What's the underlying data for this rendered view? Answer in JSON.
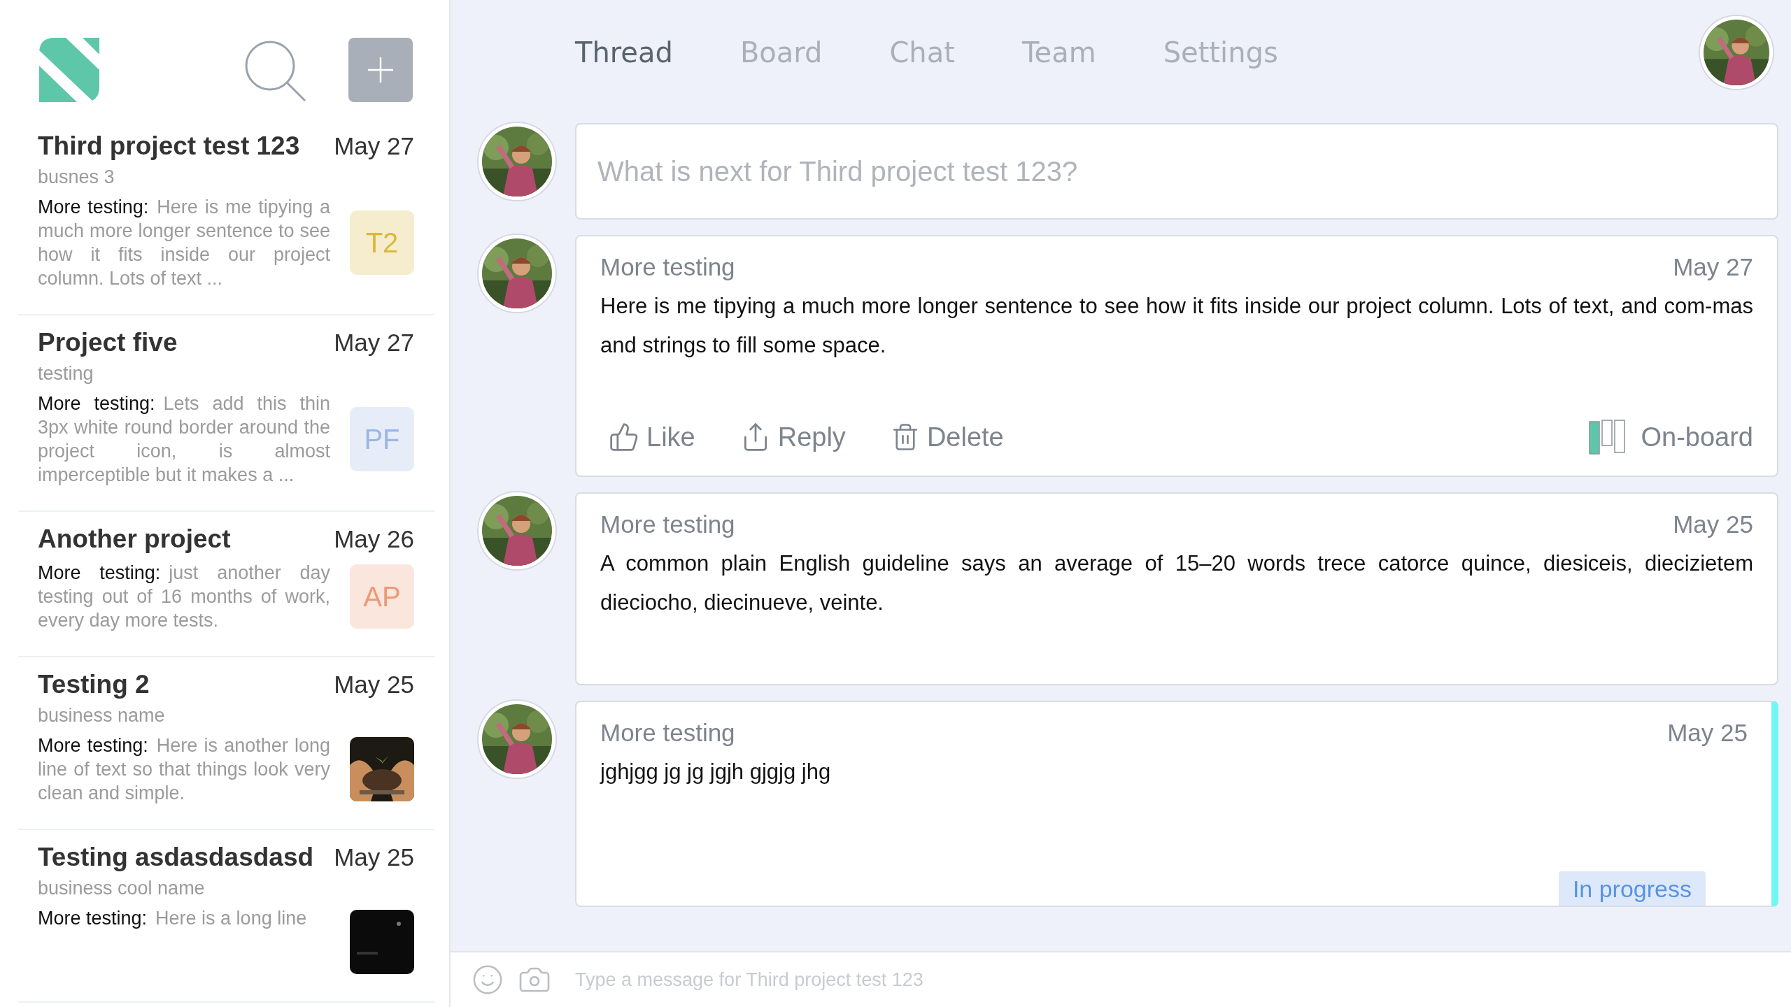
{
  "sidebar": {
    "projects": [
      {
        "title": "Third project test 123",
        "subtitle": "busnes 3",
        "date": "May 27",
        "label": "More testing:",
        "preview": "Here is me tipying a much more longer sentence to see how it fits inside our project column. Lots of text ...",
        "icon": {
          "kind": "initials",
          "text": "T2",
          "color": "#d9b93a"
        }
      },
      {
        "title": "Project five",
        "subtitle": "testing",
        "date": "May 27",
        "label": "More testing:",
        "preview": "Lets add this thin 3px white round border around the project icon, is almost imperceptible but it makes a ...",
        "icon": {
          "kind": "initials",
          "text": "PF",
          "color": "#9ab6e8"
        }
      },
      {
        "title": "Another project",
        "date": "May 26",
        "label": "More testing:",
        "preview": "just another day testing out of 16 months of work, every day more tests.",
        "icon": {
          "kind": "initials",
          "text": "AP",
          "color": "#eb9a76"
        }
      },
      {
        "title": "Testing 2",
        "subtitle": "business name",
        "date": "May 25",
        "label": "More testing:",
        "preview": "Here is another long line of text so that things look very clean and simple."
      },
      {
        "title": "Testing asdasdasdasd",
        "subtitle": "business cool name",
        "date": "May 25",
        "label": "More testing:",
        "preview": "Here is a long line"
      }
    ]
  },
  "nav": {
    "tabs": [
      {
        "label": "Thread",
        "selected": true
      },
      {
        "label": "Board",
        "selected": false
      },
      {
        "label": "Chat",
        "selected": false
      },
      {
        "label": "Team",
        "selected": false
      },
      {
        "label": "Settings",
        "selected": false
      }
    ]
  },
  "composer": {
    "placeholder": "What is next for Third project test 123?"
  },
  "posts": [
    {
      "heading": "More testing",
      "date": "May 27",
      "body": "Here is me tipying a much more longer sentence to see how it fits inside our project column. Lots of text, and com-mas and strings to fill some space.",
      "highlighted": false,
      "actions": [
        {
          "kind": "like",
          "label": "Like"
        },
        {
          "kind": "reply",
          "label": "Reply"
        },
        {
          "kind": "delete",
          "label": "Delete"
        }
      ],
      "board": {
        "label": "On-board"
      }
    },
    {
      "heading": "More testing",
      "date": "May 25",
      "body": "A common plain English guideline says an average of 15–20 words trece catorce quince, diesiceis, diecizietem dieciocho, diecinueve, veinte.",
      "highlighted": false
    },
    {
      "heading": "More testing",
      "date": "May 25",
      "body": "jghjgg jg jg jgjh gjgjg jhg",
      "highlighted": true,
      "status": "In progress"
    }
  ],
  "message_bar": {
    "placeholder": "Type a message for Third project test 123"
  }
}
